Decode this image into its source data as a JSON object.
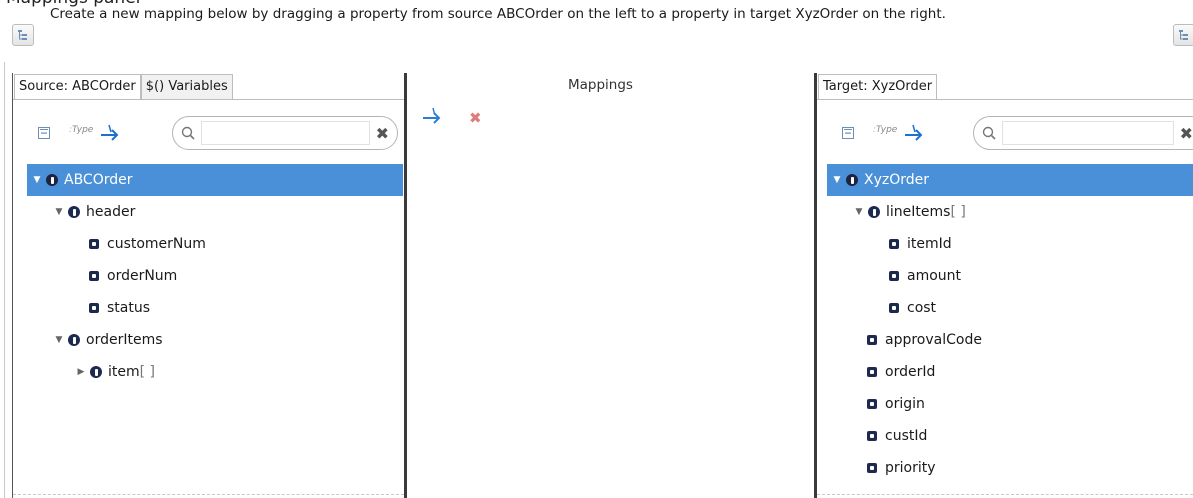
{
  "page": {
    "partial_title": "Mappings panel"
  },
  "instructions": "Create a new mapping below by dragging a property from source ABCOrder on the left to a property in target XyzOrder  on the right.",
  "source": {
    "tabs": [
      "Source: ABCOrder",
      "$() Variables"
    ],
    "search": {
      "placeholder": ""
    },
    "type_label": "Type",
    "tree": {
      "root": "ABCOrder",
      "header": "header",
      "header_children": [
        "customerNum",
        "orderNum",
        "status"
      ],
      "orderItems": "orderItems",
      "item": "item",
      "item_bracket": "[ ]"
    }
  },
  "mappings": {
    "title": "Mappings",
    "add_icon": "add-mapping-arrow-icon",
    "delete_icon": "delete-mapping-icon"
  },
  "target": {
    "tabs": [
      "Target: XyzOrder"
    ],
    "search": {
      "placeholder": ""
    },
    "type_label": "Type",
    "tree": {
      "root": "XyzOrder",
      "lineItems": "lineItems",
      "lineItems_bracket": "[ ]",
      "lineItems_children": [
        "itemId",
        "amount",
        "cost"
      ],
      "fields": [
        "approvalCode",
        "orderId",
        "origin",
        "custId",
        "priority"
      ]
    }
  },
  "colors": {
    "selection": "#4a90d9",
    "node_icon": "#1d2a4f",
    "map_arrow": "#2a7fd4",
    "delete_x": "#e07b7b"
  }
}
